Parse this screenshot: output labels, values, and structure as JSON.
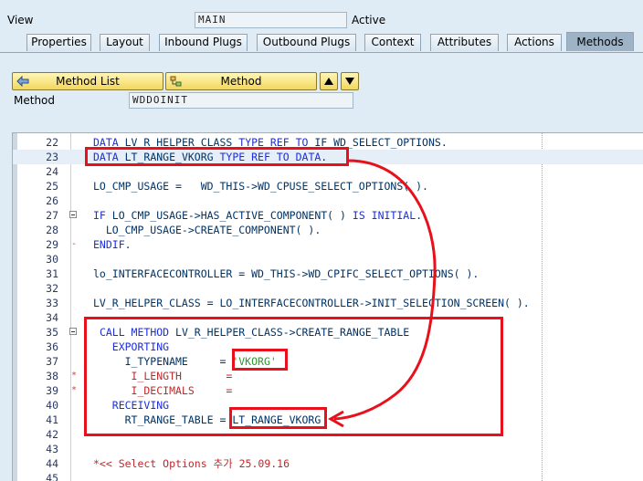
{
  "header": {
    "view_label": "View",
    "view_value": "MAIN",
    "view_status": "Active",
    "method_label": "Method",
    "method_value": "WDDOINIT"
  },
  "tabs": [
    "Properties",
    "Layout",
    "Inbound Plugs",
    "Outbound Plugs",
    "Context",
    "Attributes",
    "Actions",
    "Methods"
  ],
  "active_tab": "Methods",
  "toolbar": {
    "method_list_label": "Method List",
    "method_label": "Method"
  },
  "code_lines": [
    {
      "n": "22",
      "c": "DATA LV_R_HELPER_CLASS TYPE REF TO IF_WD_SELECT_OPTIONS."
    },
    {
      "n": "23",
      "c": "DATA LT_RANGE_VKORG TYPE REF TO DATA."
    },
    {
      "n": "24",
      "c": ""
    },
    {
      "n": "25",
      "c": "LO_CMP_USAGE =   WD_THIS->WD_CPUSE_SELECT_OPTIONS( )."
    },
    {
      "n": "26",
      "c": ""
    },
    {
      "n": "27",
      "c": "IF LO_CMP_USAGE->HAS_ACTIVE_COMPONENT( ) IS INITIAL."
    },
    {
      "n": "28",
      "c": "  LO_CMP_USAGE->CREATE_COMPONENT( )."
    },
    {
      "n": "29",
      "c": "ENDIF."
    },
    {
      "n": "30",
      "c": ""
    },
    {
      "n": "31",
      "c": "lo_INTERFACECONTROLLER = WD_THIS->WD_CPIFC_SELECT_OPTIONS( )."
    },
    {
      "n": "32",
      "c": ""
    },
    {
      "n": "33",
      "c": "LV_R_HELPER_CLASS = LO_INTERFACECONTROLLER->INIT_SELECTION_SCREEN( )."
    },
    {
      "n": "34",
      "c": ""
    },
    {
      "n": "35",
      "c": " CALL METHOD LV_R_HELPER_CLASS->CREATE_RANGE_TABLE"
    },
    {
      "n": "36",
      "c": "   EXPORTING"
    },
    {
      "n": "37",
      "c": "     I_TYPENAME     = 'VKORG'"
    },
    {
      "n": "38",
      "c": "      I_LENGTH       ="
    },
    {
      "n": "39",
      "c": "      I_DECIMALS     ="
    },
    {
      "n": "40",
      "c": "   RECEIVING"
    },
    {
      "n": "41",
      "c": "     RT_RANGE_TABLE = LT_RANGE_VKORG"
    },
    {
      "n": "42",
      "c": ""
    },
    {
      "n": "43",
      "c": ""
    },
    {
      "n": "44",
      "c": "*<< Select Options 추가 25.09.16"
    },
    {
      "n": "45",
      "c": ""
    }
  ],
  "annotations": {
    "box_color": "#e8101b",
    "arrow_color": "#e8101b"
  }
}
